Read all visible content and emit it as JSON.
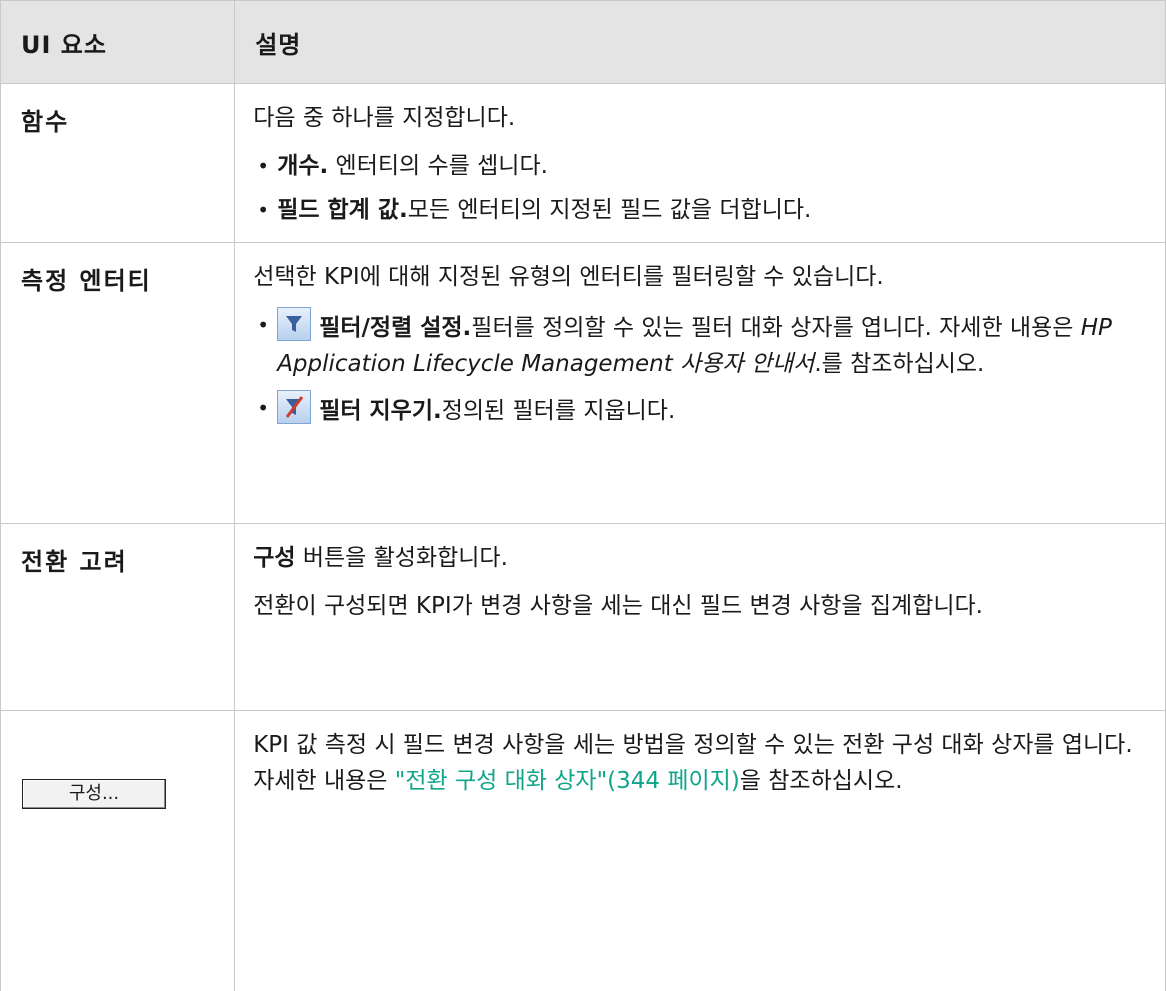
{
  "header": {
    "col_ui": "UI 요소",
    "col_desc": "설명"
  },
  "rows": [
    {
      "ui": "함수",
      "intro": "다음 중 하나를 지정합니다.",
      "bullets": [
        {
          "bold": "개수.",
          "text": " 엔터티의 수를 셉니다."
        },
        {
          "bold": "필드 합계 값.",
          "text": "모든 엔터티의 지정된 필드 값을 더합니다."
        }
      ]
    },
    {
      "ui": "측정 엔터티",
      "intro": "선택한 KPI에 대해 지정된 유형의 엔터티를 필터링할 수 있습니다.",
      "bullets": [
        {
          "icon": "filter-sort-icon",
          "bold": "필터/정렬 설정.",
          "text": "필터를 정의할 수 있는 필터 대화 상자를 엽니다. 자세한 내용은 ",
          "italic": "HP Application Lifecycle Management 사용자 안내서",
          "text2": ".를 참조하십시오."
        },
        {
          "icon": "clear-filter-icon",
          "bold": "필터 지우기.",
          "text": "정의된 필터를 지웁니다."
        }
      ]
    },
    {
      "ui": "전환 고려",
      "p1_bold": "구성",
      "p1_text": " 버튼을 활성화합니다.",
      "p2": "전환이 구성되면 KPI가 변경 사항을 세는 대신 필드 변경 사항을 집계합니다."
    },
    {
      "ui_button": "구성...",
      "text": "KPI 값 측정 시 필드 변경 사항을 세는 방법을 정의할 수 있는 전환 구성 대화 상자를 엽니다. 자세한 내용은 ",
      "link": "\"전환 구성 대화 상자\"(344 페이지)",
      "text2": "을 참조하십시오."
    }
  ],
  "colors": {
    "link": "#11a58a",
    "header_bg": "#e4e4e4",
    "border": "#c9c9c9"
  }
}
